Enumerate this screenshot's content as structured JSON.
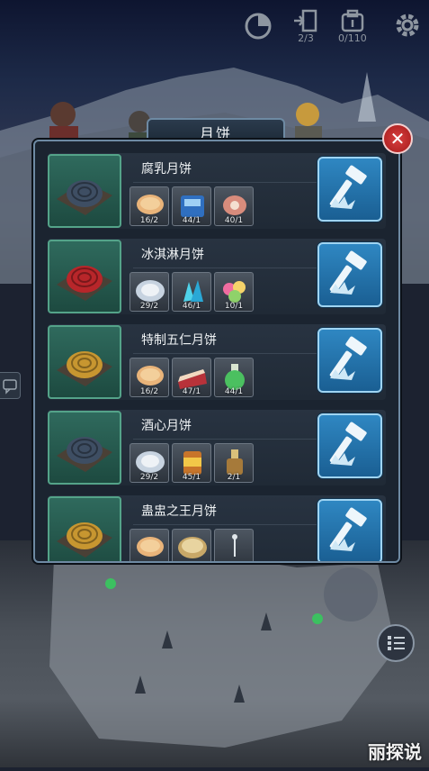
{
  "hud": {
    "cycle_label": "",
    "exit_count": "2/3",
    "bag_count": "0/110"
  },
  "dialog": {
    "title": "月饼"
  },
  "recipes": [
    {
      "name": "腐乳月饼",
      "cake_color": "#3e4e63",
      "ingredients": [
        {
          "icon": "flatbread-icon",
          "count": "16/2"
        },
        {
          "icon": "blue-machine-icon",
          "count": "44/1"
        },
        {
          "icon": "meat-icon",
          "count": "40/1"
        }
      ]
    },
    {
      "name": "冰淇淋月饼",
      "cake_color": "#b8262a",
      "ingredients": [
        {
          "icon": "flour-icon",
          "count": "29/2"
        },
        {
          "icon": "ice-crystal-icon",
          "count": "46/1"
        },
        {
          "icon": "candy-icon",
          "count": "10/1"
        }
      ]
    },
    {
      "name": "特制五仁月饼",
      "cake_color": "#c79630",
      "ingredients": [
        {
          "icon": "flatbread-icon",
          "count": "16/2"
        },
        {
          "icon": "cake-slice-icon",
          "count": "47/1"
        },
        {
          "icon": "potion-icon",
          "count": "44/1"
        }
      ]
    },
    {
      "name": "酒心月饼",
      "cake_color": "#3e4e63",
      "ingredients": [
        {
          "icon": "flour-icon",
          "count": "29/2"
        },
        {
          "icon": "can-icon",
          "count": "45/1"
        },
        {
          "icon": "bottle-icon",
          "count": "2/1"
        }
      ]
    },
    {
      "name": "蛊盅之王月饼",
      "cake_color": "#c79630",
      "ingredients": [
        {
          "icon": "flatbread-icon",
          "count": ""
        },
        {
          "icon": "drum-icon",
          "count": ""
        },
        {
          "icon": "pin-icon",
          "count": ""
        }
      ]
    }
  ],
  "watermark": "丽探说",
  "colors": {
    "panel_border": "#6e8aa3",
    "craft_button": "#2f87c2",
    "item_slot": "#2f6a5d",
    "close_button": "#c62d2d"
  }
}
